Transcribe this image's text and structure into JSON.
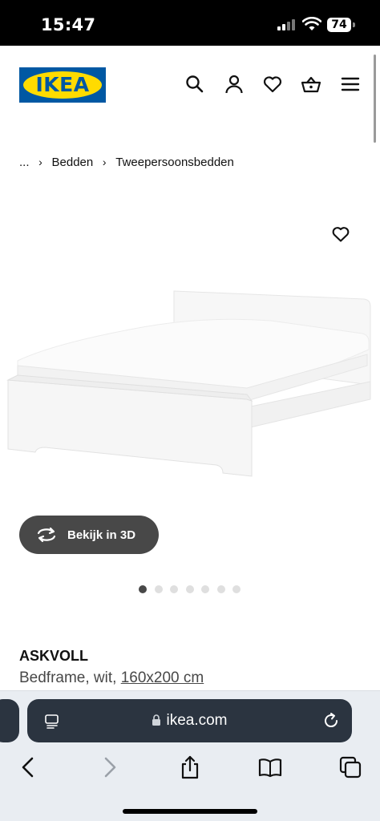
{
  "status_bar": {
    "time": "15:47",
    "battery": "74"
  },
  "header": {
    "logo_text": "IKEA",
    "brand_color": "#0058a3",
    "logo_yellow": "#ffdb00"
  },
  "breadcrumb": {
    "items": [
      "...",
      "Bedden",
      "Tweepersoonsbedden"
    ]
  },
  "media": {
    "view3d_label": "Bekijk in 3D",
    "slide_count": 7,
    "active_slide": 1
  },
  "product": {
    "name": "ASKVOLL",
    "desc_prefix": "Bedframe, wit, ",
    "size": "160x200 cm"
  },
  "browser": {
    "url": "ikea.com"
  },
  "icons": [
    "search-icon",
    "account-icon",
    "wishlist-heart-icon",
    "cart-basket-icon",
    "menu-icon",
    "favorite-heart-icon",
    "rotate-3d-icon",
    "reader-icon",
    "lock-icon",
    "reload-icon",
    "back-icon",
    "forward-icon",
    "share-icon",
    "bookmarks-icon",
    "tabs-icon"
  ]
}
